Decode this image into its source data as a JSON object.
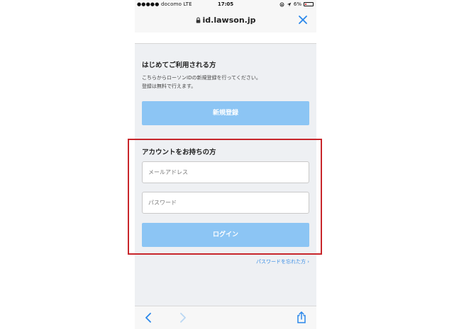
{
  "status_bar": {
    "carrier": "●●●●● docomo  LTE",
    "time": "17:05",
    "battery": "6%"
  },
  "browser": {
    "url": "id.lawson.jp"
  },
  "new_user": {
    "title": "はじめてご利用される方",
    "desc_line1": "こちらからローソンIDの新規登録を行ってください。",
    "desc_line2": "登録は無料で行えます。",
    "register_button": "新規登録"
  },
  "login": {
    "title": "アカウントをお持ちの方",
    "email_placeholder": "メールアドレス",
    "password_placeholder": "パスワード",
    "login_button": "ログイン",
    "forgot_link": "パスワードを忘れた方 ›"
  },
  "colors": {
    "accent": "#2a87ea",
    "button": "#8cc5f4",
    "highlight": "#c8262b"
  }
}
